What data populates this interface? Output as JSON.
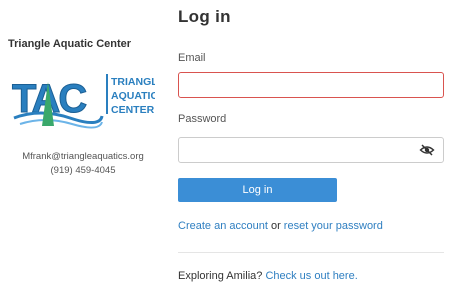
{
  "org": {
    "name": "Triangle Aquatic Center",
    "logo_initials": "TAC",
    "logo_lines": [
      "TRIANGLE",
      "AQUATIC",
      "CENTER"
    ],
    "email": "Mfrank@triangleaquatics.org",
    "phone": "(919) 459-4045"
  },
  "login": {
    "title": "Log in",
    "email_label": "Email",
    "email_value": "",
    "password_label": "Password",
    "password_value": "",
    "submit_label": "Log in",
    "create_account_link": "Create an account",
    "or_text": " or ",
    "reset_password_link": "reset your password",
    "explore_text": "Exploring Amilia? ",
    "explore_link": "Check us out here."
  },
  "colors": {
    "accent": "#3b8ed6",
    "link": "#2f7fc1",
    "error_border": "#d9534f",
    "logo_blue": "#2a7fbf",
    "logo_green": "#3aa86b"
  },
  "icons": {
    "password_toggle": "eye-slash-icon"
  }
}
